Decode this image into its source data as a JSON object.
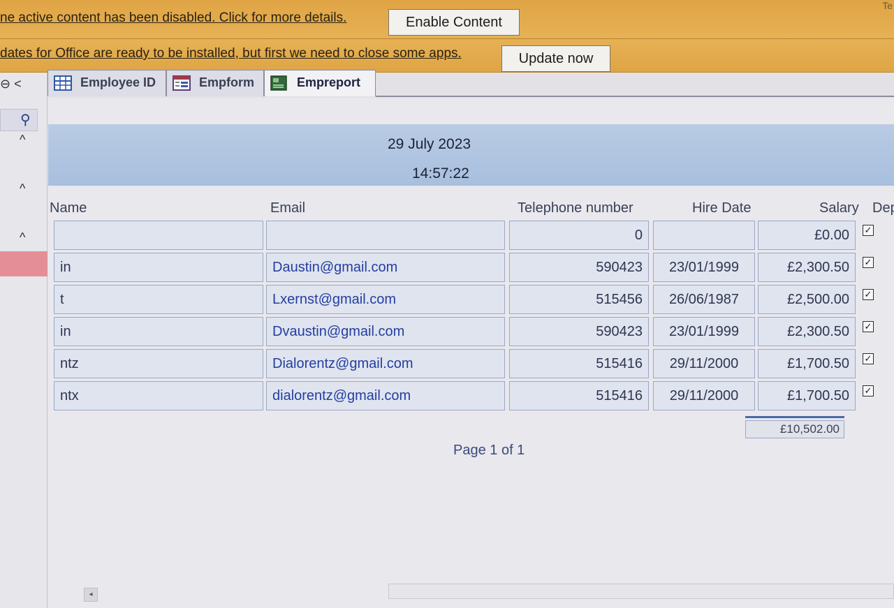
{
  "message_bars": {
    "security": {
      "text": "ne active content has been disabled. Click for more details.",
      "button": "Enable Content"
    },
    "updates": {
      "text": "dates for Office are ready to be installed, but first we need to close some apps.",
      "button": "Update now"
    },
    "corner_text": "Te"
  },
  "nav": {
    "top_glyph": "⊖ <",
    "search_glyph": "⚲",
    "chevron": "^"
  },
  "tabs": [
    {
      "label": "Employee ID",
      "icon": "table-icon"
    },
    {
      "label": "Empform",
      "icon": "form-icon"
    },
    {
      "label": "Empreport",
      "icon": "report-icon",
      "active": true
    }
  ],
  "report": {
    "date": "29 July 2023",
    "time": "14:57:22",
    "columns": {
      "name": "Name",
      "email": "Email",
      "telephone": "Telephone number",
      "hire_date": "Hire Date",
      "salary": "Salary",
      "dept": "Dep"
    },
    "rows": [
      {
        "name": "",
        "email": "",
        "telephone": "0",
        "hire_date": "",
        "salary": "£0.00",
        "checked": true
      },
      {
        "name": "in",
        "email": "Daustin@gmail.com",
        "telephone": "590423",
        "hire_date": "23/01/1999",
        "salary": "£2,300.50",
        "checked": true
      },
      {
        "name": "t",
        "email": "Lxernst@gmail.com",
        "telephone": "515456",
        "hire_date": "26/06/1987",
        "salary": "£2,500.00",
        "checked": true
      },
      {
        "name": "in",
        "email": "Dvaustin@gmail.com",
        "telephone": "590423",
        "hire_date": "23/01/1999",
        "salary": "£2,300.50",
        "checked": true
      },
      {
        "name": "ntz",
        "email": "Dialorentz@gmail.com",
        "telephone": "515416",
        "hire_date": "29/11/2000",
        "salary": "£1,700.50",
        "checked": true
      },
      {
        "name": "ntx",
        "email": "dialorentz@gmail.com",
        "telephone": "515416",
        "hire_date": "29/11/2000",
        "salary": "£1,700.50",
        "checked": true
      }
    ],
    "total_salary": "£10,502.00",
    "page_label": "Page 1 of 1"
  }
}
